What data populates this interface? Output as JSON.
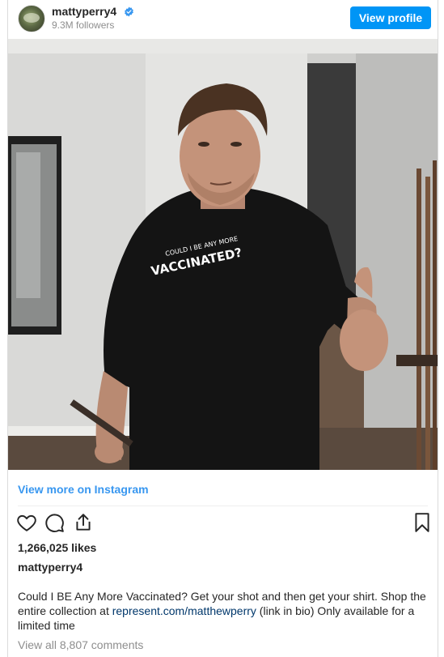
{
  "header": {
    "username": "mattyperry4",
    "followers": "9.3M followers",
    "view_profile_label": "View profile"
  },
  "photo": {
    "shirt_text_line1": "COULD I BE ANY MORE",
    "shirt_text_line2": "VACCINATED?"
  },
  "view_more_label": "View more on Instagram",
  "actions": {
    "icons": [
      "heart-icon",
      "comment-icon",
      "share-icon",
      "bookmark-icon"
    ]
  },
  "likes": "1,266,025 likes",
  "caption": {
    "username": "mattyperry4",
    "text_before": "Could I BE Any More Vaccinated? Get your shot and then get your shirt. Shop the entire collection at ",
    "link": "represent.com/matthewperry",
    "text_after": " (link in bio) Only available for a limited time"
  },
  "comments_label": "View all 8,807 comments",
  "colors": {
    "accent": "#0095f6",
    "link_blue": "#3897f0",
    "verified": "#3897f0",
    "muted": "#8e8e8e"
  }
}
